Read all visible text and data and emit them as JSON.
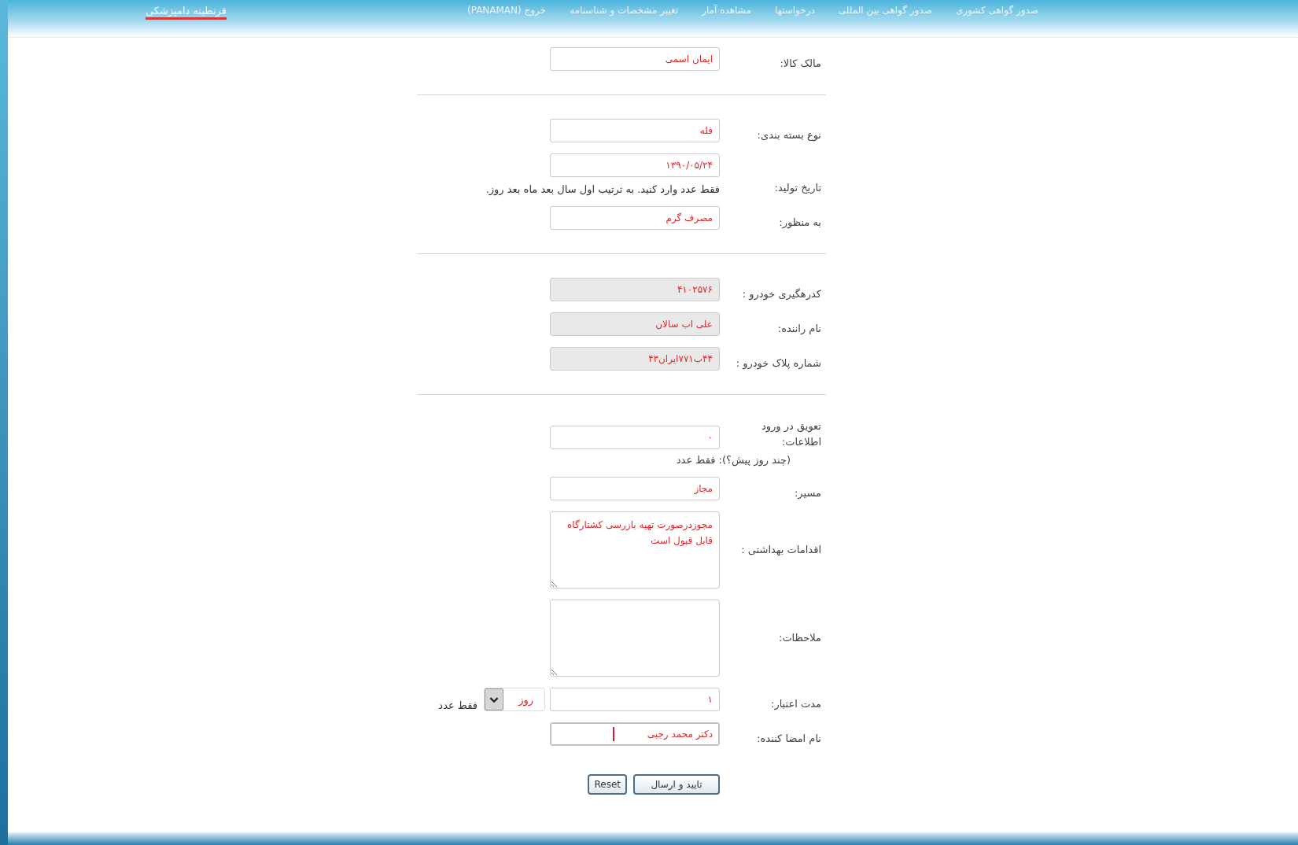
{
  "header": {
    "logo": "قرنطینه دامپزشکی",
    "nav": [
      "صدور گواهی کشوری",
      "صدور گواهی بین المللی",
      "درخواستها",
      "مشاهده آمار",
      "تغییر مشخصات و شناسنامه",
      "خروج (PANAMAN)"
    ]
  },
  "sections": [
    {
      "fields": [
        {
          "kind": "text",
          "label": "مالک کالا:",
          "value": "ایمان اسمی",
          "focused": false
        }
      ]
    },
    {
      "fields": [
        {
          "kind": "text",
          "label": "نوع بسته بندی:",
          "value": "فله",
          "focused": false
        },
        {
          "kind": "text",
          "label": "تاریخ تولید:",
          "value": "۱۳۹۰/۰۵/۲۴",
          "hint": "فقط عدد وارد کنید. به ترتیب اول سال بعد ماه بعد روز.",
          "focused": false
        },
        {
          "kind": "text",
          "label": "به منظور:",
          "value": "مصرف گرم",
          "focused": false
        }
      ]
    },
    {
      "fields": [
        {
          "kind": "readonly",
          "label": "کدرهگیری خودرو :",
          "value": "۴۱۰۲۵۷۶",
          "focused": false
        },
        {
          "kind": "readonly",
          "label": "نام راننده:",
          "value": "علی اب سالان",
          "focused": false
        },
        {
          "kind": "readonly",
          "label": "شماره پلاک خودرو :",
          "value": "۴۴ب۷۷۱ایران۴۳",
          "focused": false
        }
      ]
    },
    {
      "fields": [
        {
          "kind": "text",
          "label": "تعویق در ورود اطلاعات:",
          "sublabel": "(چند روز پیش؟): فقط عدد",
          "value": "۰",
          "focused": false
        },
        {
          "kind": "text",
          "label": "مسیر:",
          "value": "مجاز",
          "focused": false
        },
        {
          "kind": "textarea",
          "label": "اقدامات بهداشتی :",
          "value": "مجوزدرصورت تهیه بازرسی کشتارگاه قابل قبول است",
          "focused": false
        },
        {
          "kind": "textarea",
          "label": "ملاحظات:",
          "focused": false
        },
        {
          "kind": "text",
          "label": "مدت اعتبار:",
          "value": "۱",
          "unit": "روز",
          "note": "فقط عدد",
          "focused": false
        },
        {
          "kind": "text",
          "label": "نام امضا کننده:",
          "value": "دکتر محمد رجبی",
          "focused": true
        }
      ]
    }
  ],
  "buttons": [
    {
      "kind": "submit",
      "label": "تایید و ارسال"
    },
    {
      "kind": "reset",
      "label": "Reset"
    }
  ]
}
